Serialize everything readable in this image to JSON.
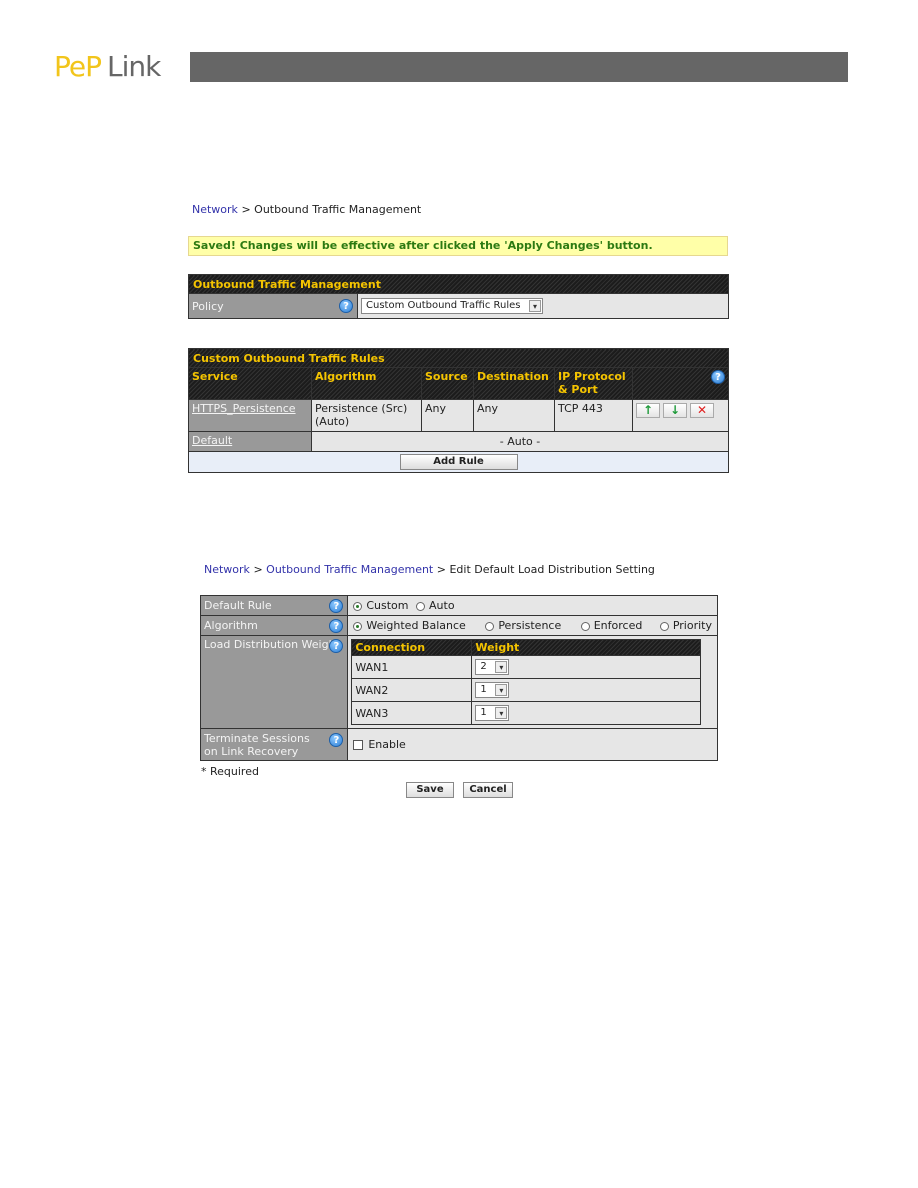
{
  "brand": {
    "logo_primary": "PeP",
    "logo_secondary": "Link"
  },
  "section1": {
    "breadcrumb": {
      "root": "Network",
      "sep": ">",
      "current": "Outbound Traffic Management"
    },
    "saved_message": "Saved! Changes will be effective after clicked the 'Apply Changes' button.",
    "otm_panel": {
      "title": "Outbound Traffic Management",
      "policy_label": "Policy",
      "policy_value": "Custom Outbound Traffic Rules"
    },
    "rules_panel": {
      "title": "Custom Outbound Traffic Rules",
      "columns": [
        "Service",
        "Algorithm",
        "Source",
        "Destination",
        "IP Protocol & Port"
      ],
      "rows": [
        {
          "service": "HTTPS_Persistence",
          "algorithm": "Persistence (Src) (Auto)",
          "source": "Any",
          "destination": "Any",
          "protocol_port": "TCP 443"
        }
      ],
      "default_row": {
        "service": "Default",
        "value": "- Auto -"
      },
      "add_rule_label": "Add Rule",
      "icons": {
        "help": "?",
        "up": "↑",
        "down": "↓",
        "delete": "✕"
      }
    }
  },
  "section2": {
    "breadcrumb": {
      "root": "Network",
      "sep": ">",
      "middle": "Outbound Traffic Management",
      "current": "Edit Default Load Distribution Setting"
    },
    "default_rule": {
      "label": "Default Rule",
      "options": [
        "Custom",
        "Auto"
      ],
      "selected": "Custom"
    },
    "algorithm": {
      "label": "Algorithm",
      "options": [
        "Weighted Balance",
        "Persistence",
        "Enforced",
        "Priority"
      ],
      "selected": "Weighted Balance"
    },
    "load_distribution": {
      "label": "Load Distribution Weight",
      "columns": [
        "Connection",
        "Weight"
      ],
      "rows": [
        {
          "connection": "WAN1",
          "weight": "2"
        },
        {
          "connection": "WAN2",
          "weight": "1"
        },
        {
          "connection": "WAN3",
          "weight": "1"
        }
      ]
    },
    "terminate": {
      "label": "Terminate Sessions on Link Recovery",
      "checkbox_label": "Enable",
      "checked": false
    },
    "required_note": "* Required",
    "save_label": "Save",
    "cancel_label": "Cancel"
  },
  "colors": {
    "header_text": "#f5c400",
    "saved_text": "#2c7a12",
    "saved_bg": "#ffffa8",
    "link": "#3333aa"
  }
}
